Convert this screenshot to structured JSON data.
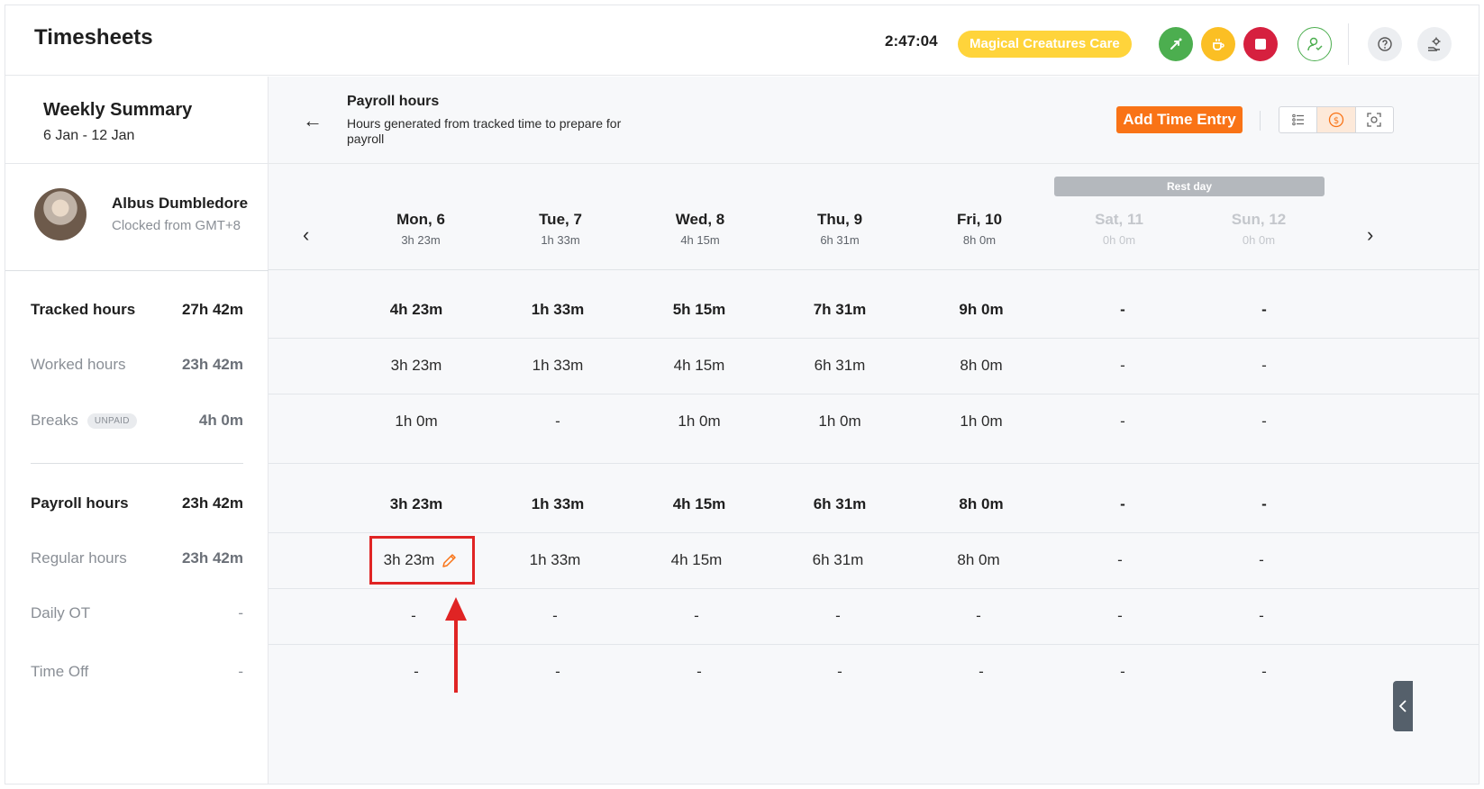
{
  "header": {
    "title": "Timesheets",
    "timer": "2:47:04",
    "project": "Magical Creatures Care",
    "icons": [
      "switch-activity-icon",
      "coffee-break-icon",
      "stop-icon",
      "user-check-icon",
      "help-icon",
      "settings-icon"
    ]
  },
  "summary": {
    "title": "Weekly Summary",
    "range": "6 Jan - 12 Jan"
  },
  "user": {
    "name": "Albus Dumbledore",
    "timezone": "Clocked from GMT+8"
  },
  "stats": {
    "tracked": {
      "label": "Tracked hours",
      "value": "27h 42m"
    },
    "worked": {
      "label": "Worked hours",
      "value": "23h 42m"
    },
    "breaks": {
      "label": "Breaks",
      "badge": "UNPAID",
      "value": "4h 0m"
    },
    "payroll": {
      "label": "Payroll hours",
      "value": "23h 42m"
    },
    "regular": {
      "label": "Regular hours",
      "value": "23h 42m"
    },
    "daily_ot": {
      "label": "Daily OT",
      "value": "-"
    },
    "time_off": {
      "label": "Time Off",
      "value": "-"
    }
  },
  "main": {
    "back_arrow": "←",
    "title": "Payroll hours",
    "subtitle": "Hours generated from tracked time to prepare for payroll",
    "add_button": "Add Time Entry",
    "rest_day": "Rest day",
    "prev": "‹",
    "next": "›",
    "accent_color": "#f97316"
  },
  "days": [
    {
      "name": "Mon, 6",
      "total": "3h 23m"
    },
    {
      "name": "Tue, 7",
      "total": "1h 33m"
    },
    {
      "name": "Wed, 8",
      "total": "4h 15m"
    },
    {
      "name": "Thu, 9",
      "total": "6h 31m"
    },
    {
      "name": "Fri, 10",
      "total": "8h 0m"
    },
    {
      "name": "Sat, 11",
      "total": "0h 0m"
    },
    {
      "name": "Sun, 12",
      "total": "0h 0m"
    }
  ],
  "rows": {
    "tracked": [
      "4h 23m",
      "1h 33m",
      "5h 15m",
      "7h 31m",
      "9h 0m",
      "-",
      "-"
    ],
    "worked": [
      "3h 23m",
      "1h 33m",
      "4h 15m",
      "6h 31m",
      "8h 0m",
      "-",
      "-"
    ],
    "breaks": [
      "1h 0m",
      "-",
      "1h 0m",
      "1h 0m",
      "1h 0m",
      "-",
      "-"
    ],
    "payroll": [
      "3h 23m",
      "1h 33m",
      "4h 15m",
      "6h 31m",
      "8h 0m",
      "-",
      "-"
    ],
    "regular": [
      "3h 23m",
      "1h 33m",
      "4h 15m",
      "6h 31m",
      "8h 0m",
      "-",
      "-"
    ],
    "daily_ot": [
      "-",
      "-",
      "-",
      "-",
      "-",
      "-",
      "-"
    ],
    "time_off": [
      "-",
      "-",
      "-",
      "-",
      "-",
      "-",
      "-"
    ]
  }
}
